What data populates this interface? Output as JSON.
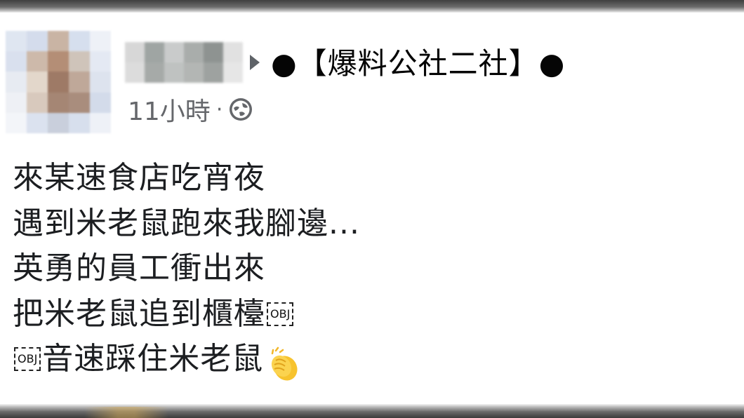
{
  "post": {
    "group_name": "●【爆料公社二社】●",
    "timestamp": "11小時",
    "separator": "·",
    "privacy_icon": "public-globe-icon",
    "lines": [
      "來某速食店吃宵夜",
      "遇到米老鼠跑來我腳邊...",
      "英勇的員工衝出來",
      "把米老鼠追到櫃檯",
      "音速踩住米老鼠"
    ],
    "object_placeholder": "OBJ",
    "reaction_emoji": "clapping-hands-icon"
  },
  "colors": {
    "text": "#1c1e21",
    "meta_text": "#65676b",
    "emoji_yellow": "#f7c32e"
  }
}
